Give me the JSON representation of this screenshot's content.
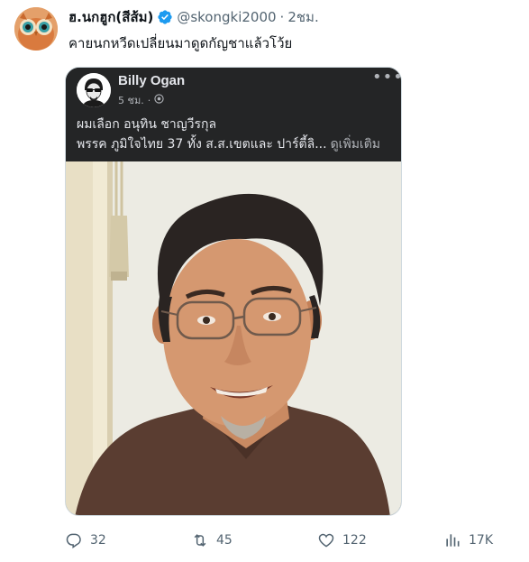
{
  "tweet": {
    "display_name": "ฮ.นกฮูก(สีส้ม)",
    "handle": "@skongki2000",
    "separator": "·",
    "time": "2ชม.",
    "text": "คายนกหวีดเปลี่ยนมาดูดกัญชาแล้วโว้ย"
  },
  "embedded_post": {
    "author": "Billy Ogan",
    "time": "5 ชม.",
    "meta_separator": "·",
    "body_line1": "ผมเลือก อนุทิน ชาญวีรกุล",
    "body_line2": "พรรค ภูมิใจไทย 37 ทั้ง ส.ส.เขตและ ปาร์ตี้ลิ...",
    "see_more": "ดูเพิ่มเติม",
    "more_label": "•••"
  },
  "actions": {
    "replies": "32",
    "retweets": "45",
    "likes": "122",
    "views": "17K"
  },
  "colors": {
    "text_primary": "#0f1419",
    "text_secondary": "#536471",
    "verified": "#1d9bf0",
    "fb_dark": "#242526"
  }
}
